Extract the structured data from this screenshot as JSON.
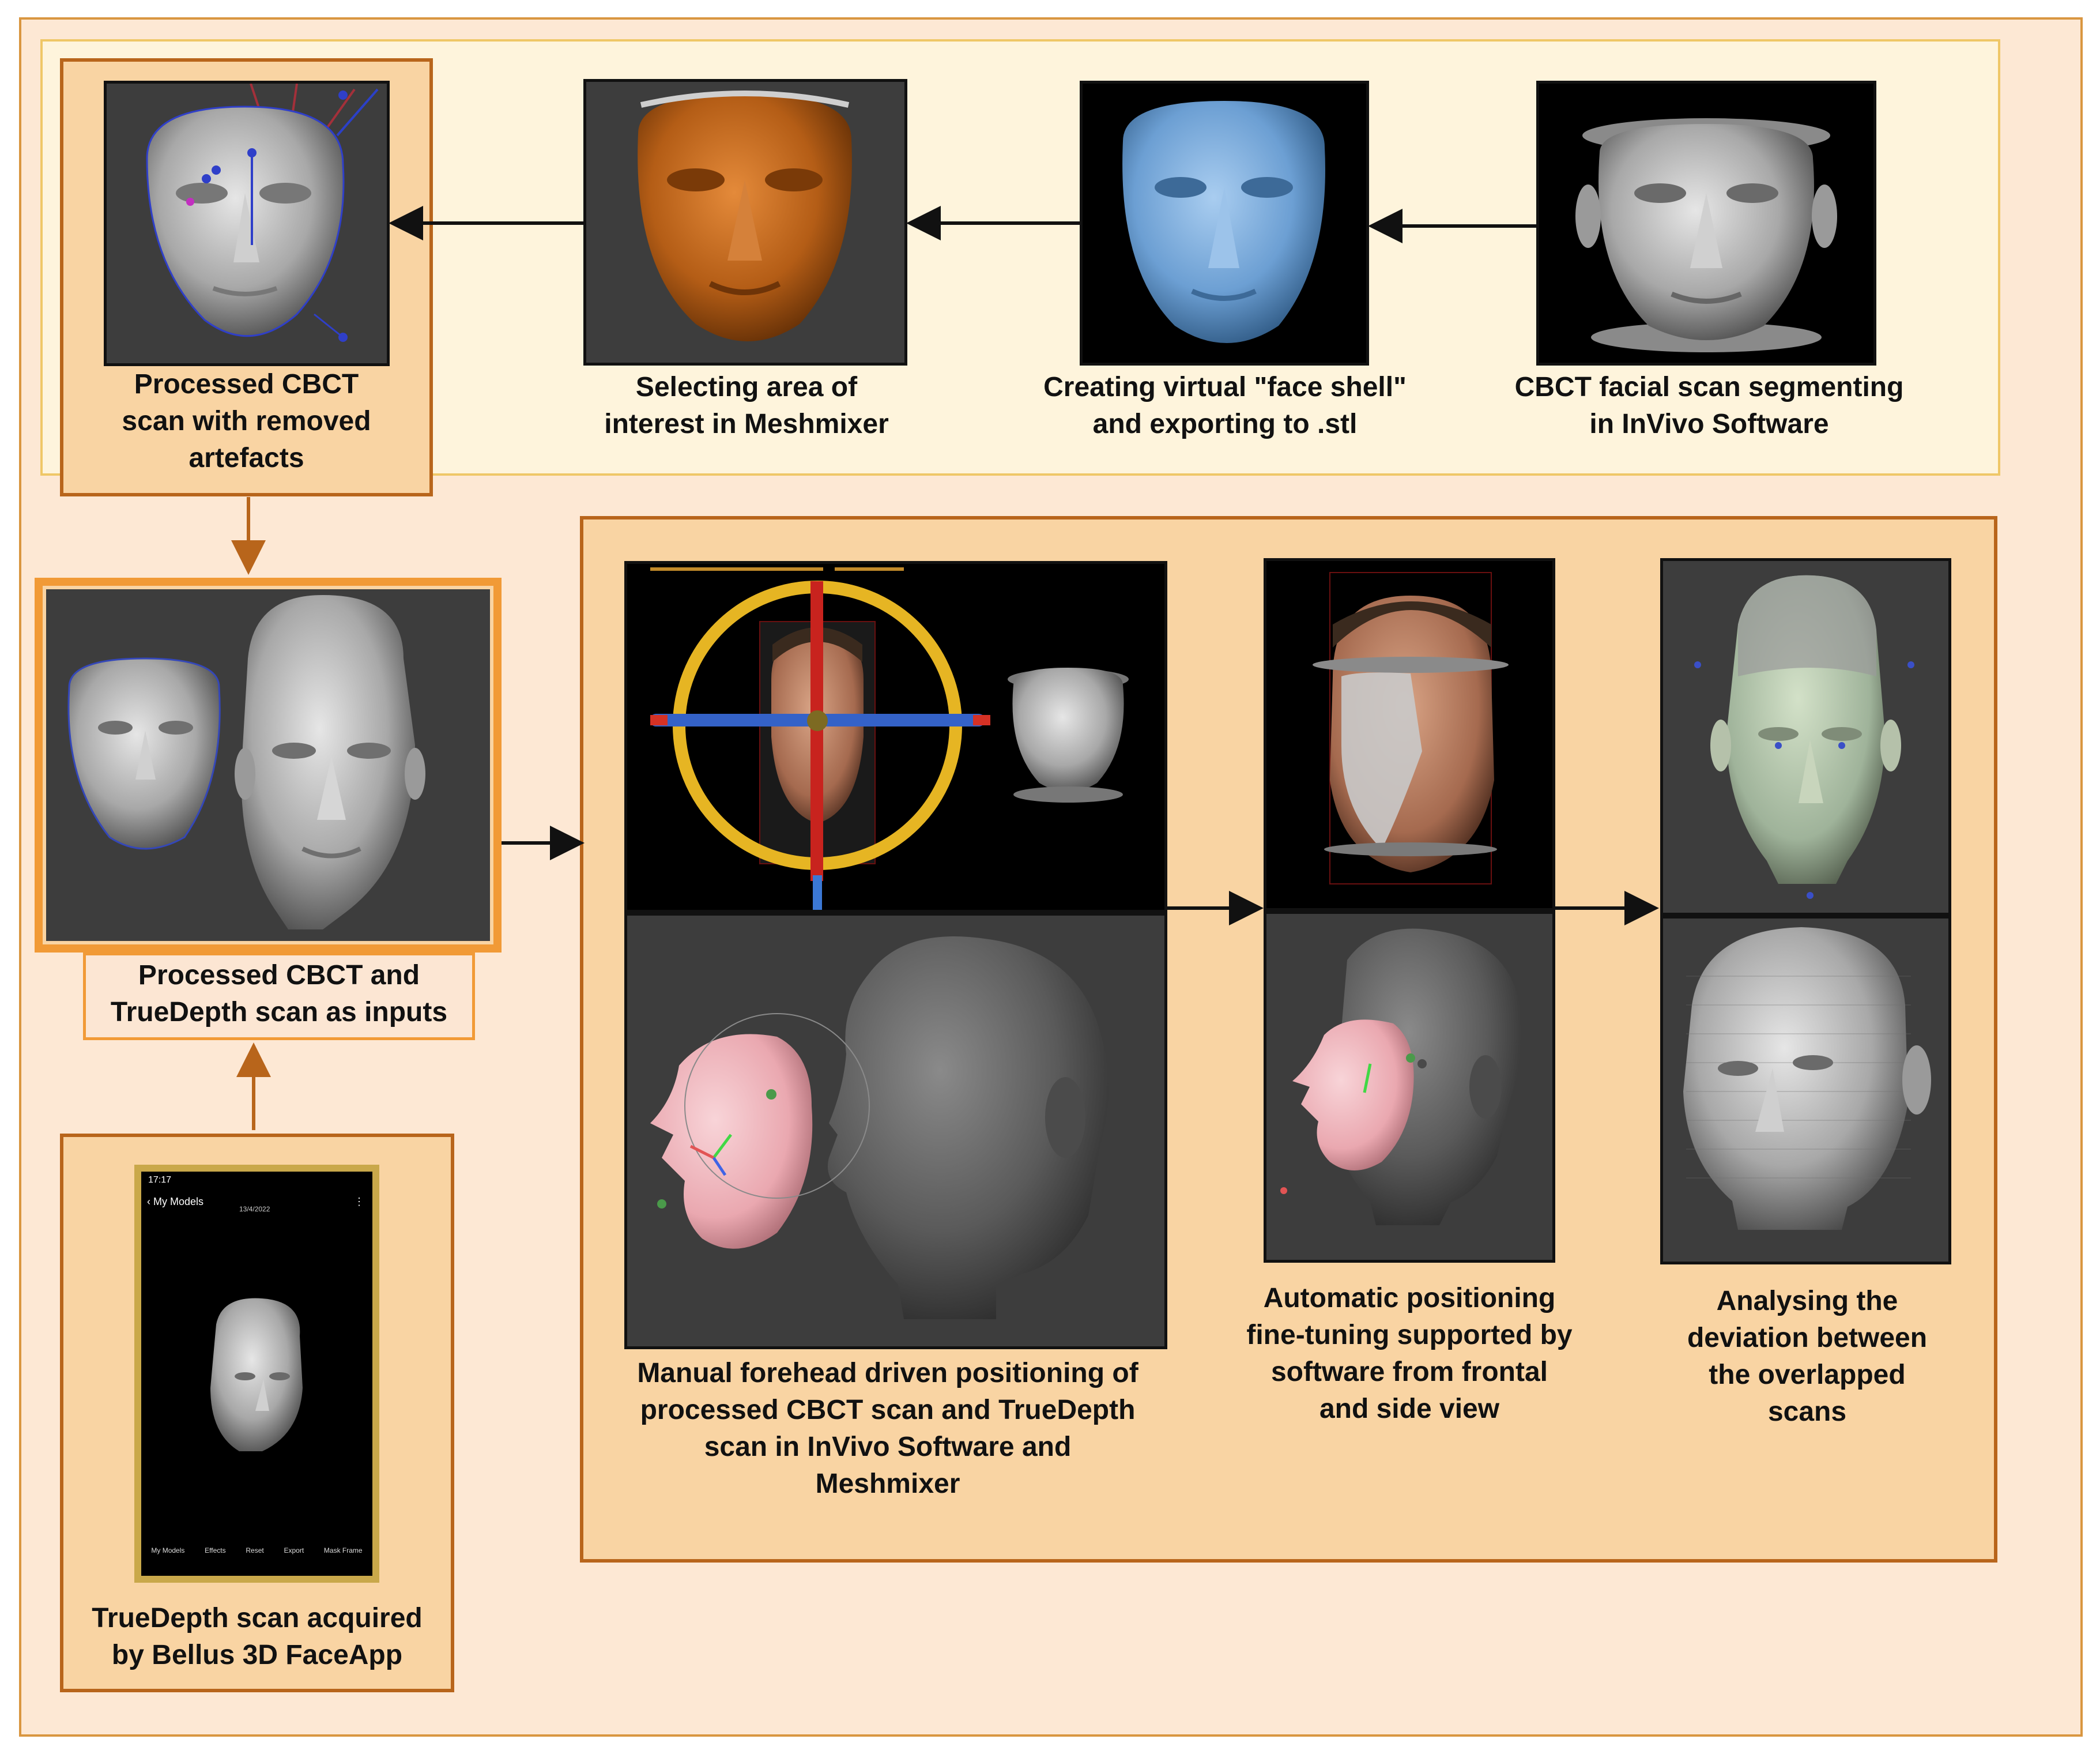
{
  "steps": {
    "processed_cbct": [
      "Processed CBCT",
      "scan with removed",
      "artefacts"
    ],
    "selecting_area": [
      "Selecting area of",
      "interest in Meshmixer"
    ],
    "creating_shell": [
      "Creating virtual \"face shell\"",
      "and exporting to .stl"
    ],
    "segmenting": [
      "CBCT facial scan segmenting",
      "in InVivo Software"
    ],
    "inputs": [
      "Processed CBCT and",
      "TrueDepth scan as inputs"
    ],
    "truedepth": [
      "TrueDepth scan acquired",
      "by Bellus 3D FaceApp"
    ],
    "manual": [
      "Manual forehead driven positioning of",
      "processed CBCT scan and TrueDepth",
      "scan in InVivo Software and",
      "Meshmixer"
    ],
    "automatic": [
      "Automatic positioning",
      "fine-tuning supported by",
      "software  from frontal",
      "and side view"
    ],
    "analysing": [
      "Analysing the",
      "deviation between",
      "the overlapped",
      "scans"
    ]
  },
  "phone": {
    "time": "17:17",
    "back": "My Models",
    "date": "13/4/2022",
    "tabs": [
      "My Models",
      "Effects",
      "Reset",
      "Export",
      "Mask Frame"
    ]
  },
  "colors": {
    "outer_fill": "#fde8d4",
    "top_band_fill": "#fef4dc",
    "box_fill": "#f9d4a3",
    "box_border": "#b8651b",
    "highlight_border": "#f19a36",
    "mesh_orange": "#c3661c",
    "mesh_blue": "#6fa3d6",
    "mesh_grey": "#b9b9b9",
    "mesh_pink": "#f0b8bf"
  }
}
